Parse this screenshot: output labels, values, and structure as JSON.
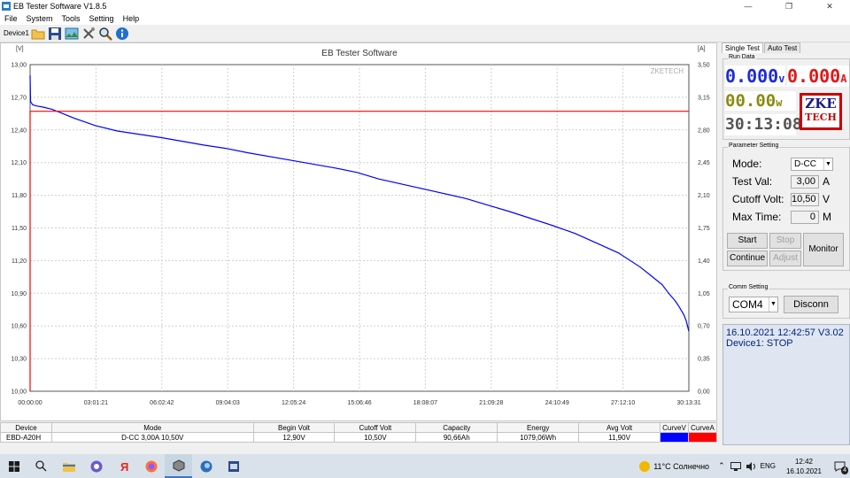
{
  "window": {
    "title": "EB Tester Software V1.8.5",
    "buttons": [
      "—",
      "❐",
      "✕"
    ]
  },
  "menu": [
    "File",
    "System",
    "Tools",
    "Setting",
    "Help"
  ],
  "toolbar": {
    "device_label": "Device1"
  },
  "chart_data": {
    "type": "line",
    "title": "EB Tester Software",
    "watermark": "ZKETECH",
    "left_unit": "[V]",
    "right_unit": "[A]",
    "y_left": {
      "range": [
        10.0,
        13.0
      ],
      "ticks": [
        "13,00",
        "12,70",
        "12,40",
        "12,10",
        "11,80",
        "11,50",
        "11,20",
        "10,90",
        "10,60",
        "10,30",
        "10,00"
      ]
    },
    "y_right": {
      "range": [
        0,
        3.5
      ],
      "ticks": [
        "3,50",
        "3,15",
        "2,80",
        "2,45",
        "2,10",
        "1,75",
        "1,40",
        "1,05",
        "0,70",
        "0,35",
        "0,00"
      ]
    },
    "x_ticks": [
      "00:00:00",
      "03:01:21",
      "06:02:42",
      "09:04:03",
      "12:05:24",
      "15:06:46",
      "18:08:07",
      "21:09:28",
      "24:10:49",
      "27:12:10",
      "30:13:31"
    ],
    "grid": true,
    "series": [
      {
        "name": "CurveV",
        "color": "#0000ff",
        "axis": "left",
        "x_hours": [
          0,
          0.02,
          0.12,
          0.3,
          0.6,
          1,
          1.5,
          2,
          3,
          4,
          6,
          8,
          9,
          10,
          12,
          14,
          15,
          16,
          18,
          20,
          21,
          22,
          24,
          25,
          26,
          27,
          28,
          28.5,
          29,
          29.3,
          29.6,
          29.8,
          30,
          30.1,
          30.226
        ],
        "y": [
          12.9,
          12.66,
          12.63,
          12.62,
          12.61,
          12.59,
          12.55,
          12.51,
          12.44,
          12.39,
          12.33,
          12.26,
          12.23,
          12.19,
          12.12,
          12.05,
          12.01,
          11.95,
          11.86,
          11.77,
          11.71,
          11.65,
          11.52,
          11.45,
          11.36,
          11.27,
          11.14,
          11.06,
          10.98,
          10.9,
          10.83,
          10.77,
          10.7,
          10.65,
          10.55
        ]
      },
      {
        "name": "CurveA",
        "color": "#ff0000",
        "axis": "right",
        "x_hours": [
          0,
          0,
          30.226
        ],
        "y": [
          0,
          3.0,
          3.0
        ]
      }
    ]
  },
  "table": {
    "headers": [
      "Device",
      "Mode",
      "Begin Volt",
      "Cutoff Volt",
      "Capacity",
      "Energy",
      "Avg Volt",
      "CurveV",
      "CurveA"
    ],
    "row": [
      "EBD-A20H",
      "D-CC  3,00A  10,50V",
      "12,90V",
      "10,50V",
      "90,66Ah",
      "1079,06Wh",
      "11,90V"
    ]
  },
  "side": {
    "tabs": [
      "Single Test",
      "Auto Test"
    ],
    "run_data": {
      "legend": "Run Data",
      "volt": "0.000",
      "volt_unit": "v",
      "amp": "0.000",
      "amp_unit": "A",
      "watt": "00.00",
      "watt_unit": "w",
      "time": "30:13:08",
      "logo_l1": "ZKE",
      "logo_l2": "TECH"
    },
    "params": {
      "legend": "Parameter Setting",
      "mode_label": "Mode:",
      "mode_value": "D-CC",
      "test_label": "Test Val:",
      "test_value": "3,00",
      "test_unit": "A",
      "cutoff_label": "Cutoff Volt:",
      "cutoff_value": "10,50",
      "cutoff_unit": "V",
      "maxtime_label": "Max Time:",
      "maxtime_value": "0",
      "maxtime_unit": "M"
    },
    "buttons": {
      "start": "Start",
      "stop": "Stop",
      "monitor": "Monitor",
      "continue": "Continue",
      "adjust": "Adjust"
    },
    "comm": {
      "legend": "Comm Setting",
      "port": "COM4",
      "disconn": "Disconn"
    },
    "status": {
      "line1": "16.10.2021 12:42:57  V3.02",
      "line2": "Device1: STOP"
    }
  },
  "taskbar": {
    "weather": "11°C  Солнечно",
    "lang": "ENG",
    "time": "12:42",
    "date": "16.10.2021",
    "notify_count": "4"
  }
}
